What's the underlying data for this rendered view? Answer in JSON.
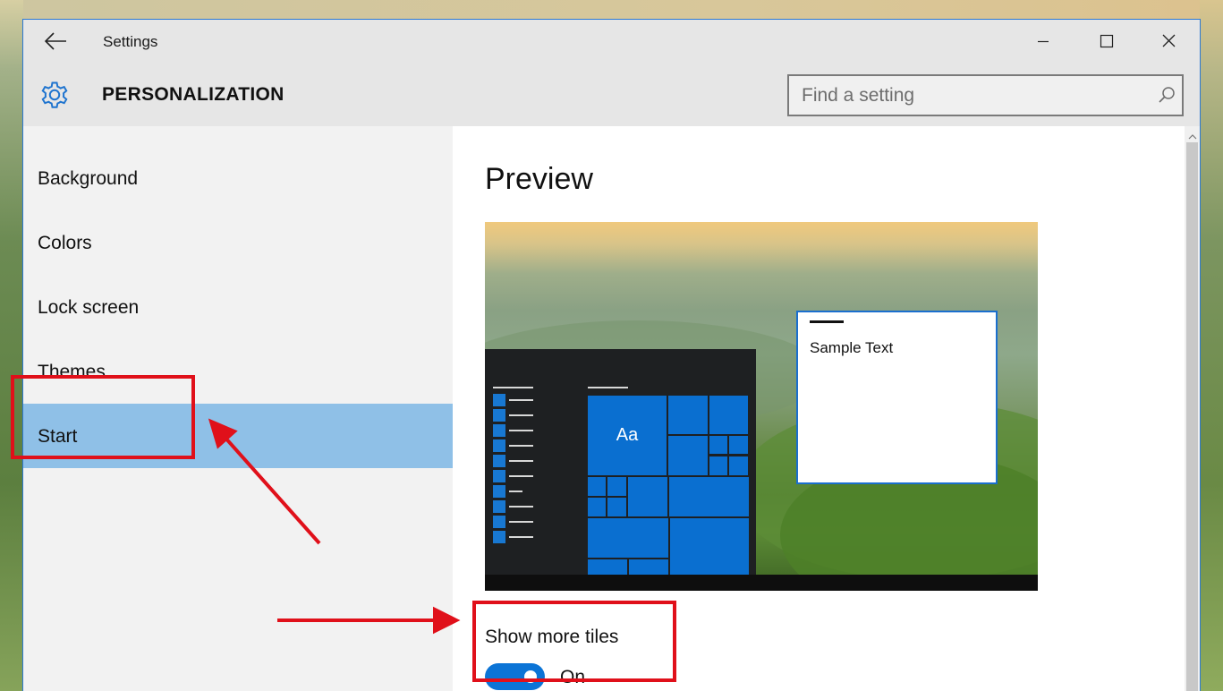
{
  "window": {
    "title": "Settings",
    "accent_color": "#2b78d4"
  },
  "header": {
    "section_title": "PERSONALIZATION",
    "section_icon": "gear-icon",
    "search_placeholder": "Find a setting"
  },
  "sidebar": {
    "items": [
      {
        "label": "Background",
        "active": false
      },
      {
        "label": "Colors",
        "active": false
      },
      {
        "label": "Lock screen",
        "active": false
      },
      {
        "label": "Themes",
        "active": false
      },
      {
        "label": "Start",
        "active": true
      }
    ],
    "active_color": "#8fc0e7"
  },
  "content": {
    "preview_title": "Preview",
    "preview": {
      "tile_label": "Aa",
      "sample_text": "Sample Text",
      "tile_color": "#0a6fd0"
    },
    "setting": {
      "label": "Show more tiles",
      "state": "On",
      "enabled": true
    }
  },
  "annotations": {
    "color": "#e0101a"
  }
}
